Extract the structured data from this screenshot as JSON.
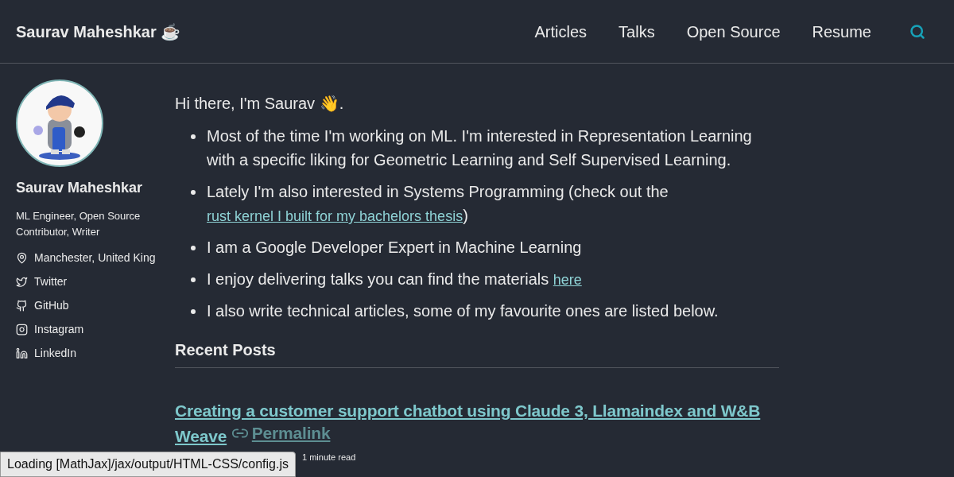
{
  "masthead": {
    "title": "Saurav Maheshkar ☕",
    "nav": [
      {
        "label": "Articles"
      },
      {
        "label": "Talks"
      },
      {
        "label": "Open Source"
      },
      {
        "label": "Resume"
      }
    ]
  },
  "sidebar": {
    "name": "Saurav Maheshkar",
    "bio": "ML Engineer, Open Source Contributor, Writer",
    "links": [
      {
        "kind": "location",
        "label": "Manchester, United King"
      },
      {
        "kind": "twitter",
        "label": "Twitter"
      },
      {
        "kind": "github",
        "label": "GitHub"
      },
      {
        "kind": "instagram",
        "label": "Instagram"
      },
      {
        "kind": "linkedin",
        "label": "LinkedIn"
      }
    ]
  },
  "intro": "Hi there, I'm Saurav 👋.",
  "bullets": [
    [
      {
        "text": "Most of the time I'm working on ML. I'm interested in Representation Learning with a specific liking for Geometric Learning and Self Supervised Learning."
      }
    ],
    [
      {
        "text": "Lately I'm also interested in Systems Programming (check out the "
      },
      {
        "link": "rust kernel I built for my bachelors thesis"
      },
      {
        "text": ")"
      }
    ],
    [
      {
        "text": "I am a Google Developer Expert in Machine Learning"
      }
    ],
    [
      {
        "text": "I enjoy delivering talks you can find the materials "
      },
      {
        "link": "here"
      }
    ],
    [
      {
        "text": "I also write technical articles, some of my favourite ones are listed below."
      }
    ]
  ],
  "recent_posts": {
    "heading": "Recent Posts",
    "posts": [
      {
        "title": "Creating a customer support chatbot using Claude 3, Llamaindex and W&B Weave",
        "permalink": "Permalink",
        "read_time": "1 minute read"
      }
    ]
  },
  "status_bar": "Loading [MathJax]/jax/output/HTML-CSS/config.js"
}
